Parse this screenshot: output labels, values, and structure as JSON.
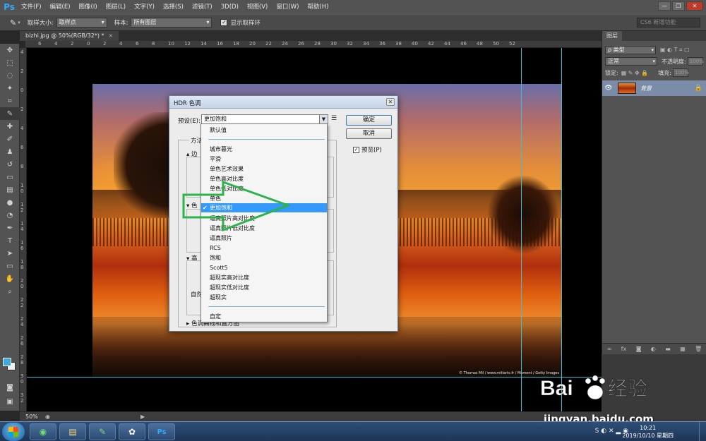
{
  "menubar": {
    "logo": "Ps",
    "items": [
      "文件(F)",
      "编辑(E)",
      "图像(I)",
      "图层(L)",
      "文字(Y)",
      "选择(S)",
      "滤镜(T)",
      "3D(D)",
      "视图(V)",
      "窗口(W)",
      "帮助(H)"
    ],
    "win_min": "—",
    "win_max": "❐",
    "win_close": "✕"
  },
  "optbar": {
    "sample_size_label": "取样大小:",
    "sample_size_value": "取样点",
    "sample_label": "样本:",
    "sample_value": "所有图层",
    "show_ring_label": "显示取样环",
    "show_ring_checked": "✓",
    "workspace": "CS6 新增功能"
  },
  "document": {
    "tab_title": "bizhi.jpg @ 50%(RGB/32*) *",
    "tab_close": "×",
    "zoom": "50%",
    "copyright": "© Thomas Mil / www.mitiarts.fr / Moment / Getty Images"
  },
  "rulers": {
    "top": [
      "6",
      "4",
      "2",
      "0",
      "2",
      "4",
      "6",
      "8",
      "10",
      "12",
      "14",
      "16",
      "18",
      "20",
      "22",
      "24",
      "26",
      "28",
      "30",
      "32",
      "34",
      "36",
      "38",
      "40",
      "42",
      "44",
      "46",
      "48",
      "50",
      "52"
    ],
    "left": [
      "4",
      "2",
      "0",
      "2",
      "4",
      "6",
      "8",
      "1 0",
      "1 2",
      "1 4",
      "1 6",
      "1 8",
      "2 0",
      "2 2",
      "2 4",
      "2 6",
      "2 8",
      "3 0",
      "3 2"
    ]
  },
  "layers_panel": {
    "tab": "图层",
    "kind_filter": "ρ 类型",
    "blend_mode": "正常",
    "opacity_label": "不透明度:",
    "opacity_value": "100%",
    "lock_label": "锁定:",
    "fill_label": "填充:",
    "fill_value": "100%",
    "layer_name": "背景",
    "footer_icons": [
      "∞",
      "fx",
      "◙",
      "◐",
      "▬",
      "▦",
      "🗑"
    ]
  },
  "hdr_dialog": {
    "title": "HDR 色调",
    "preset_label": "预设(E):",
    "preset_value": "更加饱和",
    "ok": "确定",
    "cancel": "取消",
    "preview_label": "预览(P)",
    "preview_checked": "✓",
    "method_label": "方法",
    "edge_fold": "边",
    "tone_fold": "色",
    "advanced_fold": "高",
    "natural_label": "自然",
    "curve_fold": "色调曲线和直方图"
  },
  "preset_list": {
    "items": [
      {
        "label": "默认值",
        "selected": false
      },
      {
        "label": "城市暮光",
        "selected": false
      },
      {
        "label": "平滑",
        "selected": false
      },
      {
        "label": "单色艺术效果",
        "selected": false
      },
      {
        "label": "单色高对比度",
        "selected": false
      },
      {
        "label": "单色低对比度",
        "selected": false
      },
      {
        "label": "单色",
        "selected": false
      },
      {
        "label": "更加饱和",
        "selected": true
      },
      {
        "label": "逼真照片高对比度",
        "selected": false
      },
      {
        "label": "逼真照片低对比度",
        "selected": false
      },
      {
        "label": "逼真照片",
        "selected": false
      },
      {
        "label": "RCS",
        "selected": false
      },
      {
        "label": "饱和",
        "selected": false
      },
      {
        "label": "Scott5",
        "selected": false
      },
      {
        "label": "超现实高对比度",
        "selected": false
      },
      {
        "label": "超现实低对比度",
        "selected": false
      },
      {
        "label": "超现实",
        "selected": false
      },
      {
        "label": "自定",
        "selected": false
      }
    ],
    "check": "✔"
  },
  "taskbar": {
    "time": "10:21",
    "date": "2019/10/10 星期四"
  },
  "watermark": {
    "logo_text": "Bai du 经验",
    "url": "jingyan.baidu.com"
  },
  "colors": {
    "accent": "#3399ff",
    "guide": "#39c0d8",
    "annotation": "#2db34a",
    "ps_blue": "#30a8ff"
  }
}
